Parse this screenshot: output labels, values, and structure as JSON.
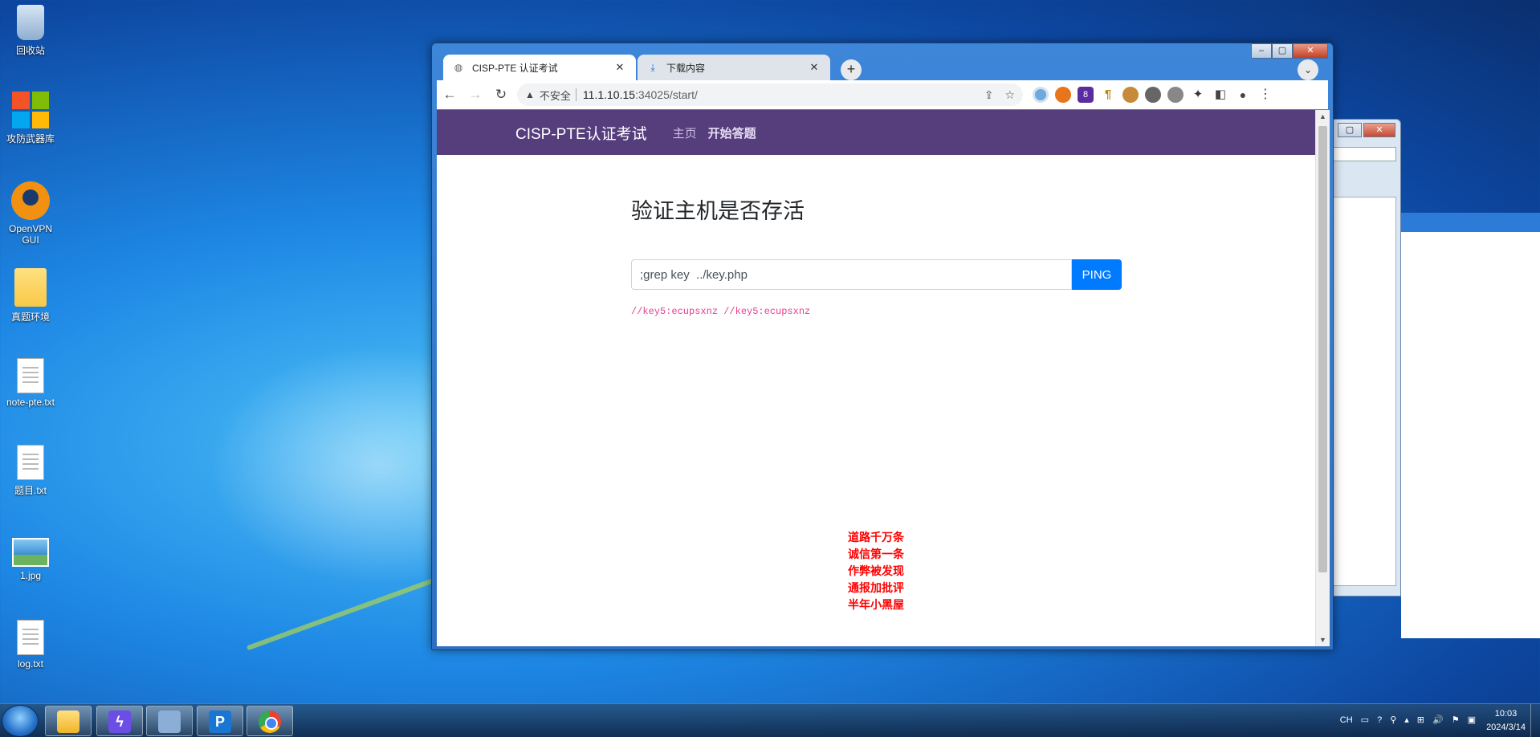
{
  "desktop": {
    "icons": [
      {
        "label": "回收站",
        "icon": "recycle-bin-icon"
      },
      {
        "label": "攻防武器库",
        "icon": "app-tiles-icon"
      },
      {
        "label": "OpenVPN GUI",
        "icon": "openvpn-icon"
      },
      {
        "label": "真题环境",
        "icon": "folder-icon"
      },
      {
        "label": "note-pte.txt",
        "icon": "text-file-icon"
      },
      {
        "label": "题目.txt",
        "icon": "text-file-icon"
      },
      {
        "label": "1.jpg",
        "icon": "image-file-icon"
      },
      {
        "label": "log.txt",
        "icon": "text-file-icon"
      }
    ]
  },
  "browser": {
    "window_controls": {
      "minimize": "–",
      "maximize": "▢",
      "close": "✕"
    },
    "tabs": [
      {
        "title": "CISP-PTE 认证考试",
        "icon": "globe-icon",
        "active": true
      },
      {
        "title": "下载内容",
        "icon": "download-icon",
        "active": false
      }
    ],
    "tab_close": "✕",
    "new_tab": "+",
    "tab_search": "⌄",
    "toolbar": {
      "back": "←",
      "forward": "→",
      "reload": "↻",
      "security_warning": "▲",
      "security_label": "不安全",
      "url_host": "11.1.10.15",
      "url_path": ":34025/start/",
      "share": "⇪",
      "bookmark": "☆",
      "extensions_badge": "8",
      "paragraph": "¶",
      "puzzle": "✦",
      "sidepanel": "◧",
      "profile": "●",
      "menu": "⋮"
    }
  },
  "page": {
    "navbar": {
      "brand": "CISP-PTE认证考试",
      "links": [
        "主页",
        "开始答题"
      ]
    },
    "heading": "验证主机是否存活",
    "form": {
      "input_value": ";grep key  ../key.php",
      "button_label": "PING"
    },
    "result_text": "//key5:ecupsxnz //key5:ecupsxnz",
    "motto": [
      "道路千万条",
      "诚信第一条",
      "作弊被发现",
      "通报加批评",
      "半年小黑屋"
    ],
    "colors": {
      "navbar": "#563d7c",
      "button": "#007bff",
      "result": "#e83e8c",
      "motto": "#ff0000"
    }
  },
  "scrollbar": {
    "up": "▲",
    "down": "▼"
  },
  "taskbar": {
    "items": [
      "explorer-icon",
      "bolt-app-icon",
      "book-app-icon",
      "ps-app-icon",
      "chrome-icon"
    ],
    "tray": [
      "CH",
      "▭",
      "?",
      "⚲",
      "▴",
      "⊞",
      "🔊",
      "⚑",
      "▣"
    ],
    "time": "10:03",
    "date": "2024/3/14"
  }
}
